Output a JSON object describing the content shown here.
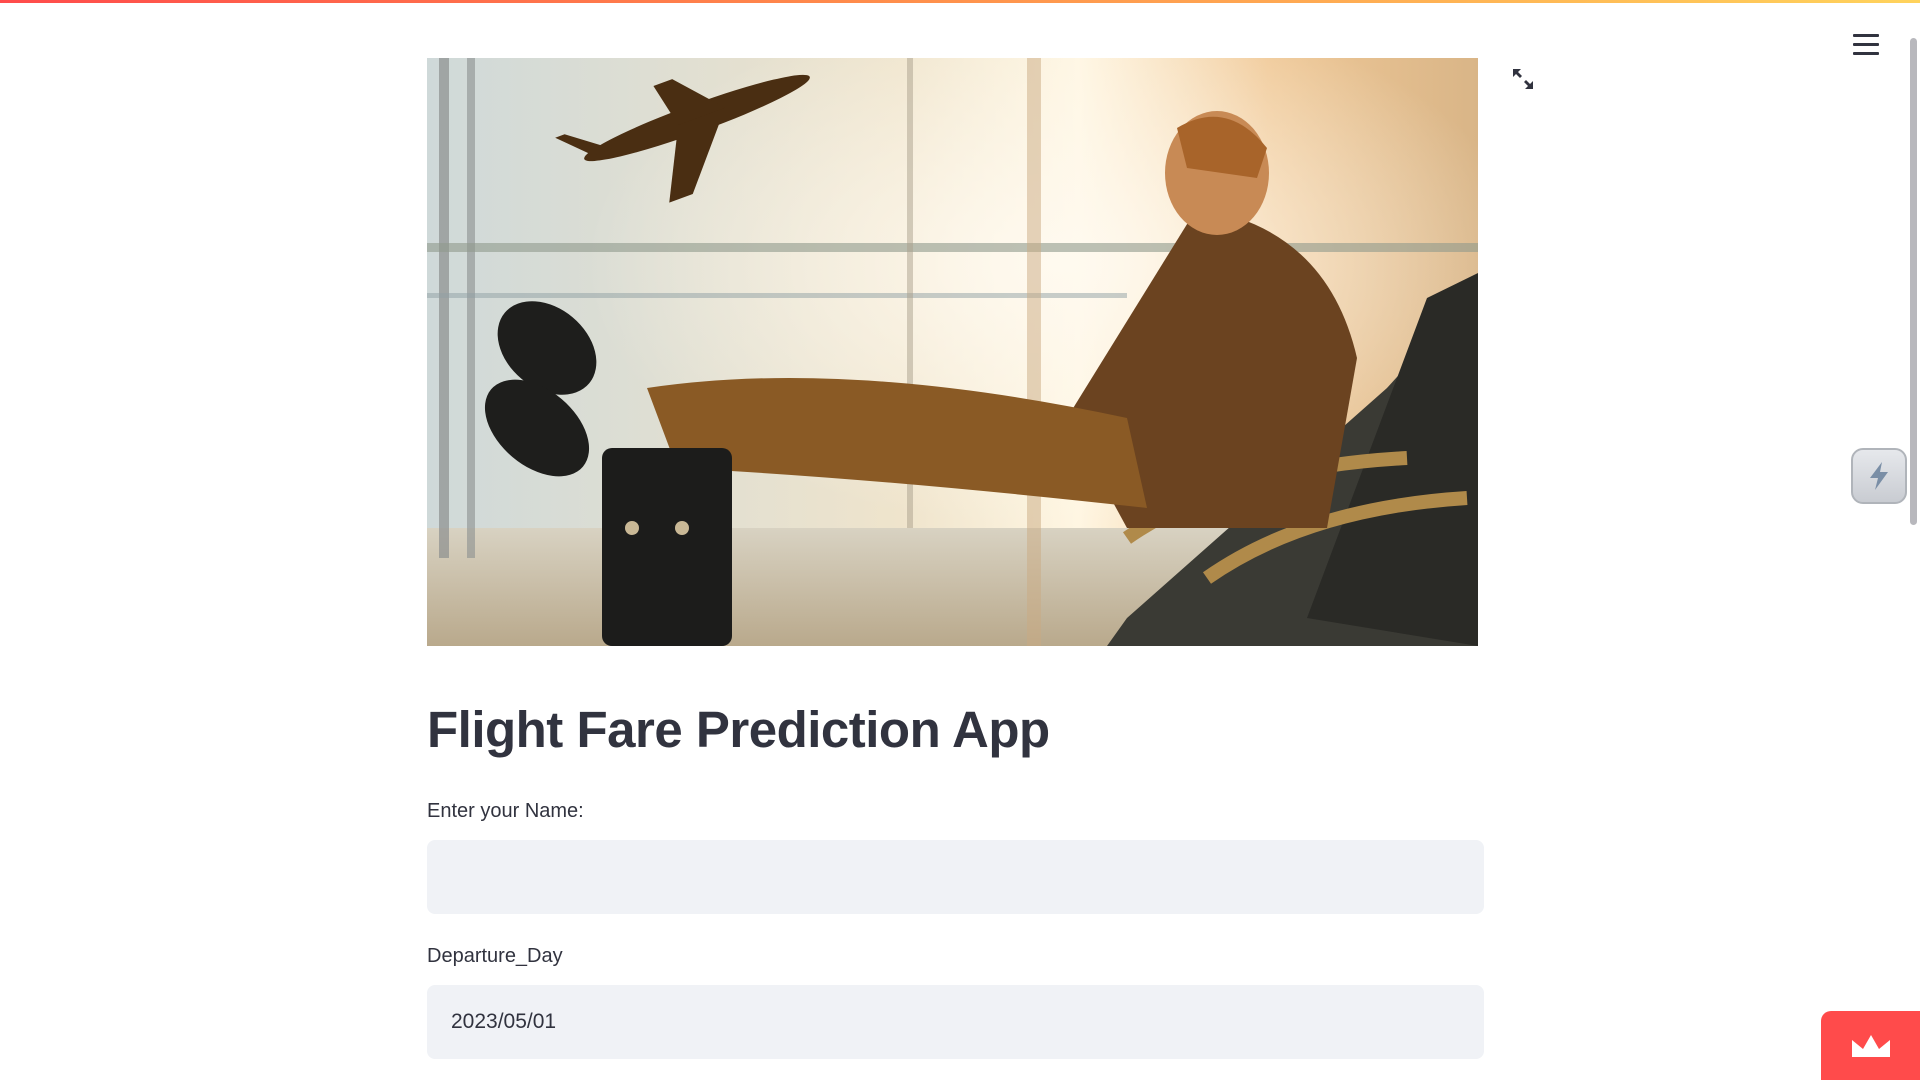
{
  "app": {
    "title": "Flight Fare Prediction App",
    "accent_color": "#ff4b4b",
    "text_color": "#31333f",
    "input_bg": "#f0f2f6"
  },
  "header": {
    "menu_icon": "hamburger-menu-icon"
  },
  "hero_image": {
    "icon": "fullscreen-expand-icon"
  },
  "form": {
    "name": {
      "label": "Enter your Name:",
      "value": "",
      "placeholder": ""
    },
    "departure_day": {
      "label": "Departure_Day",
      "value": "2023/05/01"
    }
  },
  "floating": {
    "side_widget_icon": "lightning-bolt-icon",
    "badge_icon": "crown-icon"
  }
}
